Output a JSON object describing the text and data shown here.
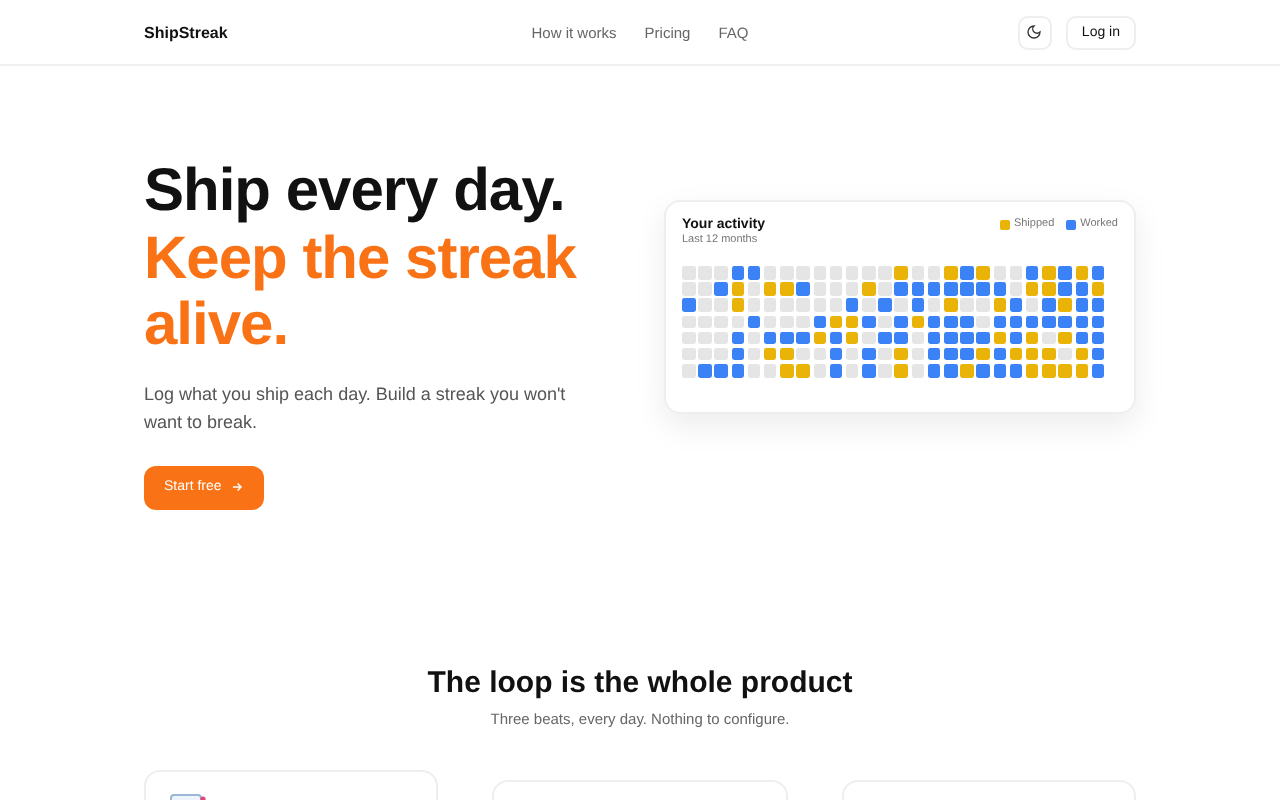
{
  "nav": {
    "brand": "ShipStreak",
    "links": [
      "How it works",
      "Pricing",
      "FAQ"
    ],
    "login": "Log in"
  },
  "hero": {
    "title_lines": [
      {
        "text": "Ship every day.",
        "accent": false
      },
      {
        "text": "Keep the streak",
        "accent": true
      },
      {
        "text": "alive.",
        "accent": true
      }
    ],
    "lead": "Log what you ship each day. Build a streak you won't want to break.",
    "cta": "Start free"
  },
  "activity": {
    "title": "Your activity",
    "subtitle": "Last 12 months",
    "legend": [
      {
        "label": "Shipped",
        "color": "#eab308"
      },
      {
        "label": "Worked",
        "color": "#3b82f6"
      }
    ],
    "rows": [
      {
        "cells": [
          {
            "kind": "none"
          },
          {
            "kind": "none"
          },
          {
            "kind": "none"
          },
          {
            "kind": "worked"
          },
          {
            "kind": "worked"
          },
          {
            "kind": "none"
          },
          {
            "kind": "none"
          },
          {
            "kind": "none"
          },
          {
            "kind": "none"
          },
          {
            "kind": "none"
          },
          {
            "kind": "none"
          },
          {
            "kind": "none"
          },
          {
            "kind": "none"
          },
          {
            "kind": "shipped"
          },
          {
            "kind": "none"
          },
          {
            "kind": "none"
          },
          {
            "kind": "shipped"
          },
          {
            "kind": "worked"
          },
          {
            "kind": "shipped"
          },
          {
            "kind": "none"
          },
          {
            "kind": "none"
          },
          {
            "kind": "worked"
          },
          {
            "kind": "shipped"
          },
          {
            "kind": "worked"
          },
          {
            "kind": "shipped"
          },
          {
            "kind": "worked"
          }
        ]
      },
      {
        "cells": [
          {
            "kind": "none"
          },
          {
            "kind": "none"
          },
          {
            "kind": "worked"
          },
          {
            "kind": "shipped"
          },
          {
            "kind": "none"
          },
          {
            "kind": "shipped"
          },
          {
            "kind": "shipped"
          },
          {
            "kind": "worked"
          },
          {
            "kind": "none"
          },
          {
            "kind": "none"
          },
          {
            "kind": "none"
          },
          {
            "kind": "shipped"
          },
          {
            "kind": "none"
          },
          {
            "kind": "worked"
          },
          {
            "kind": "worked"
          },
          {
            "kind": "worked"
          },
          {
            "kind": "worked"
          },
          {
            "kind": "worked"
          },
          {
            "kind": "worked"
          },
          {
            "kind": "worked"
          },
          {
            "kind": "none"
          },
          {
            "kind": "shipped"
          },
          {
            "kind": "shipped"
          },
          {
            "kind": "worked"
          },
          {
            "kind": "worked"
          },
          {
            "kind": "shipped"
          }
        ]
      },
      {
        "cells": [
          {
            "kind": "worked"
          },
          {
            "kind": "none"
          },
          {
            "kind": "none"
          },
          {
            "kind": "shipped"
          },
          {
            "kind": "none"
          },
          {
            "kind": "none"
          },
          {
            "kind": "none"
          },
          {
            "kind": "none"
          },
          {
            "kind": "none"
          },
          {
            "kind": "none"
          },
          {
            "kind": "worked"
          },
          {
            "kind": "none"
          },
          {
            "kind": "worked"
          },
          {
            "kind": "none"
          },
          {
            "kind": "worked"
          },
          {
            "kind": "none"
          },
          {
            "kind": "shipped"
          },
          {
            "kind": "none"
          },
          {
            "kind": "none"
          },
          {
            "kind": "shipped"
          },
          {
            "kind": "worked"
          },
          {
            "kind": "none"
          },
          {
            "kind": "worked"
          },
          {
            "kind": "shipped"
          },
          {
            "kind": "worked"
          },
          {
            "kind": "worked"
          }
        ]
      },
      {
        "cells": [
          {
            "kind": "none"
          },
          {
            "kind": "none"
          },
          {
            "kind": "none"
          },
          {
            "kind": "none"
          },
          {
            "kind": "worked"
          },
          {
            "kind": "none"
          },
          {
            "kind": "none"
          },
          {
            "kind": "none"
          },
          {
            "kind": "worked"
          },
          {
            "kind": "shipped"
          },
          {
            "kind": "shipped"
          },
          {
            "kind": "worked"
          },
          {
            "kind": "none"
          },
          {
            "kind": "worked"
          },
          {
            "kind": "shipped"
          },
          {
            "kind": "worked"
          },
          {
            "kind": "worked"
          },
          {
            "kind": "worked"
          },
          {
            "kind": "none"
          },
          {
            "kind": "worked"
          },
          {
            "kind": "worked"
          },
          {
            "kind": "worked"
          },
          {
            "kind": "worked"
          },
          {
            "kind": "worked"
          },
          {
            "kind": "worked"
          },
          {
            "kind": "worked"
          }
        ]
      },
      {
        "cells": [
          {
            "kind": "none"
          },
          {
            "kind": "none"
          },
          {
            "kind": "none"
          },
          {
            "kind": "worked"
          },
          {
            "kind": "none"
          },
          {
            "kind": "worked"
          },
          {
            "kind": "worked"
          },
          {
            "kind": "worked"
          },
          {
            "kind": "shipped"
          },
          {
            "kind": "worked"
          },
          {
            "kind": "shipped"
          },
          {
            "kind": "none"
          },
          {
            "kind": "worked"
          },
          {
            "kind": "worked"
          },
          {
            "kind": "none"
          },
          {
            "kind": "worked"
          },
          {
            "kind": "worked"
          },
          {
            "kind": "worked"
          },
          {
            "kind": "worked"
          },
          {
            "kind": "shipped"
          },
          {
            "kind": "worked"
          },
          {
            "kind": "shipped"
          },
          {
            "kind": "none"
          },
          {
            "kind": "shipped"
          },
          {
            "kind": "worked"
          },
          {
            "kind": "worked"
          }
        ]
      },
      {
        "cells": [
          {
            "kind": "none"
          },
          {
            "kind": "none"
          },
          {
            "kind": "none"
          },
          {
            "kind": "worked"
          },
          {
            "kind": "none"
          },
          {
            "kind": "shipped"
          },
          {
            "kind": "shipped"
          },
          {
            "kind": "none"
          },
          {
            "kind": "none"
          },
          {
            "kind": "worked"
          },
          {
            "kind": "none"
          },
          {
            "kind": "worked"
          },
          {
            "kind": "none"
          },
          {
            "kind": "shipped"
          },
          {
            "kind": "none"
          },
          {
            "kind": "worked"
          },
          {
            "kind": "worked"
          },
          {
            "kind": "worked"
          },
          {
            "kind": "shipped"
          },
          {
            "kind": "worked"
          },
          {
            "kind": "shipped"
          },
          {
            "kind": "shipped"
          },
          {
            "kind": "shipped"
          },
          {
            "kind": "none"
          },
          {
            "kind": "shipped"
          },
          {
            "kind": "worked"
          }
        ]
      },
      {
        "cells": [
          {
            "kind": "none"
          },
          {
            "kind": "worked"
          },
          {
            "kind": "worked"
          },
          {
            "kind": "worked"
          },
          {
            "kind": "none"
          },
          {
            "kind": "none"
          },
          {
            "kind": "shipped"
          },
          {
            "kind": "shipped"
          },
          {
            "kind": "none"
          },
          {
            "kind": "worked"
          },
          {
            "kind": "none"
          },
          {
            "kind": "worked"
          },
          {
            "kind": "none"
          },
          {
            "kind": "shipped"
          },
          {
            "kind": "none"
          },
          {
            "kind": "worked"
          },
          {
            "kind": "worked"
          },
          {
            "kind": "shipped"
          },
          {
            "kind": "worked"
          },
          {
            "kind": "worked"
          },
          {
            "kind": "worked"
          },
          {
            "kind": "shipped"
          },
          {
            "kind": "shipped"
          },
          {
            "kind": "shipped"
          },
          {
            "kind": "shipped"
          },
          {
            "kind": "worked"
          }
        ]
      }
    ]
  },
  "section": {
    "title": "The loop is the whole product",
    "subtitle": "Three beats, every day. Nothing to configure.",
    "cards": [
      {
        "kind": "note"
      },
      {
        "kind": "plain"
      },
      {
        "kind": "plain"
      }
    ]
  }
}
